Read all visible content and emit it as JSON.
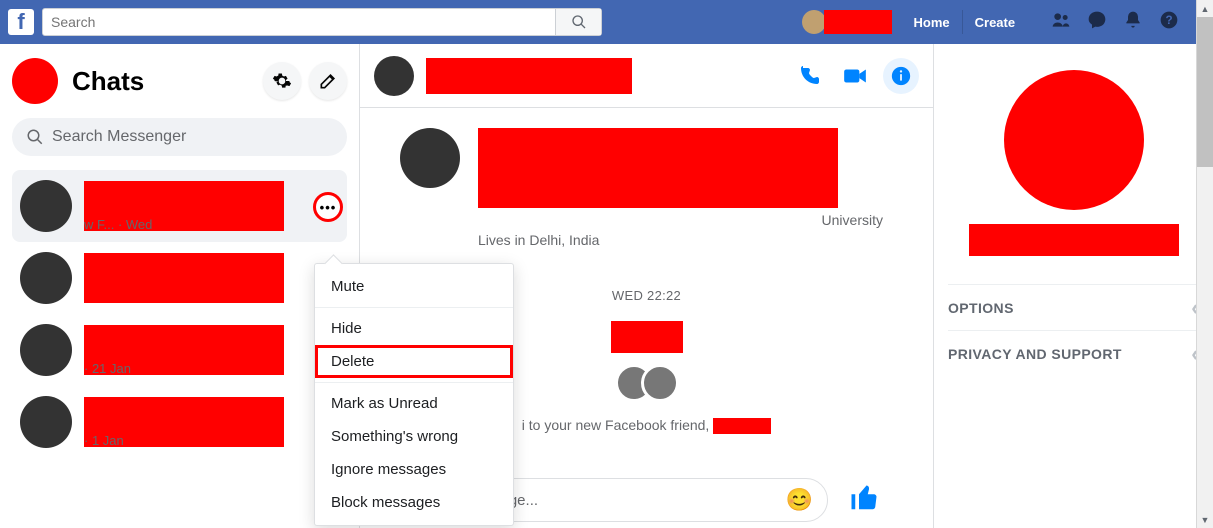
{
  "topbar": {
    "search_placeholder": "Search",
    "home": "Home",
    "create": "Create"
  },
  "sidebar": {
    "title": "Chats",
    "search_placeholder": "Search Messenger",
    "items": [
      {
        "meta": "w F...  ·  Wed"
      },
      {
        "meta": ""
      },
      {
        "meta": "·  21 Jan"
      },
      {
        "meta": "·  1 Jan"
      }
    ]
  },
  "context_menu": {
    "mute": "Mute",
    "hide": "Hide",
    "delete": "Delete",
    "mark_unread": "Mark as Unread",
    "something_wrong": "Something's wrong",
    "ignore": "Ignore messages",
    "block": "Block messages"
  },
  "conversation": {
    "profile_line1": "University",
    "profile_line2": "Lives in Delhi, India",
    "timestamp": "WED 22:22",
    "friend_text_prefix": "i to your new Facebook friend,",
    "composer_placeholder": "sage..."
  },
  "infopanel": {
    "options": "OPTIONS",
    "privacy": "PRIVACY AND SUPPORT"
  }
}
